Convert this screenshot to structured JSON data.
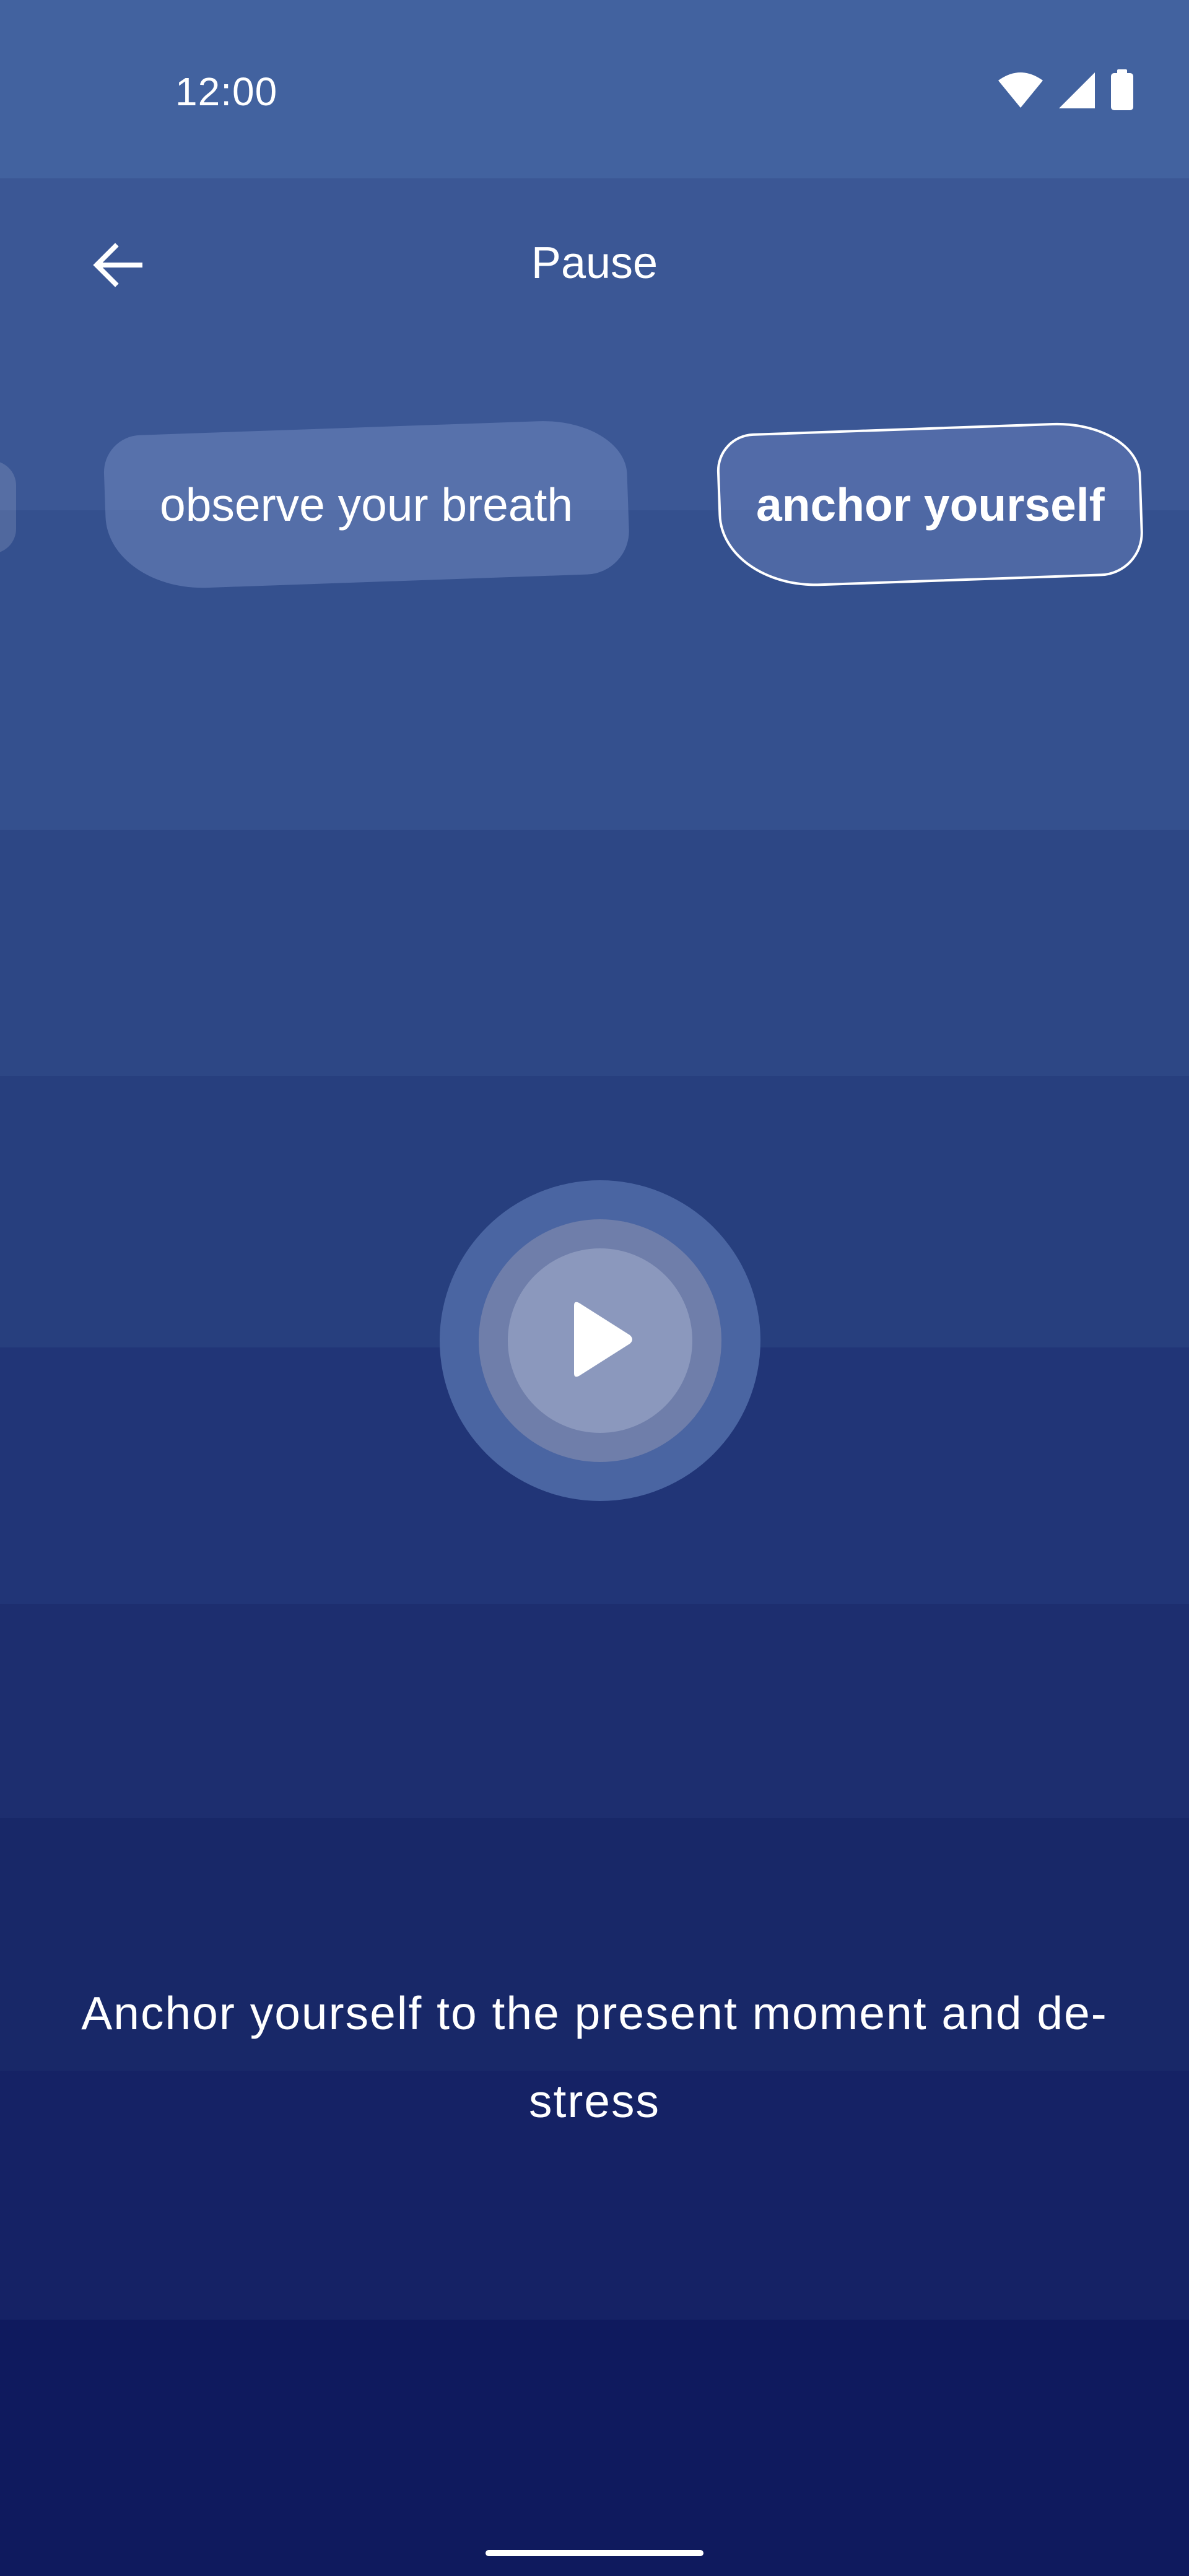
{
  "status_bar": {
    "time": "12:00",
    "icons": [
      "wifi-icon",
      "cellular-signal-icon",
      "battery-icon"
    ]
  },
  "app_bar": {
    "title": "Pause",
    "back_icon": "arrow-back-icon"
  },
  "chips": [
    {
      "label": "",
      "selected": false
    },
    {
      "label": "observe your breath",
      "selected": false
    },
    {
      "label": "anchor yourself",
      "selected": true
    }
  ],
  "player": {
    "icon": "play-icon"
  },
  "description": "Anchor yourself to the present moment and de-stress",
  "colors": {
    "background_top": "#42629f",
    "background_bottom": "#0f1a5e",
    "text": "#ffffff",
    "chip_fill": "#6f86be",
    "play_outer": "#4a65a2",
    "play_mid": "#6f7eaa",
    "play_inner": "#8b98bd"
  }
}
